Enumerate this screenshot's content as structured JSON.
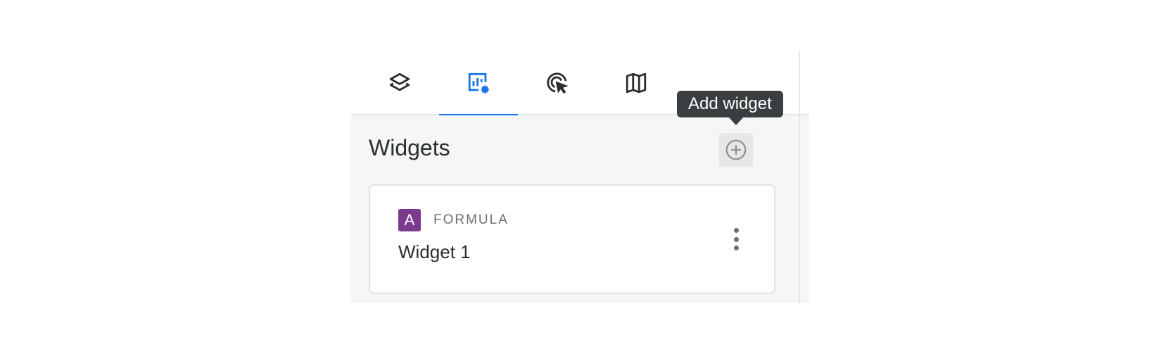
{
  "tabs": [
    {
      "id": "layers",
      "icon": "layers-icon",
      "active": false
    },
    {
      "id": "widgets",
      "icon": "chart-settings-icon",
      "active": true
    },
    {
      "id": "interactions",
      "icon": "cursor-click-icon",
      "active": false
    },
    {
      "id": "basemap",
      "icon": "map-icon",
      "active": false
    }
  ],
  "widgets_section": {
    "title": "Widgets",
    "add_tooltip": "Add widget",
    "add_icon": "plus-circle-icon"
  },
  "widget_list": [
    {
      "type_badge": "A",
      "type_label": "FORMULA",
      "name": "Widget 1"
    }
  ],
  "colors": {
    "accent": "#1a73e8",
    "formula_badge": "#7b3a8e",
    "tooltip_bg": "#3a3e40"
  }
}
